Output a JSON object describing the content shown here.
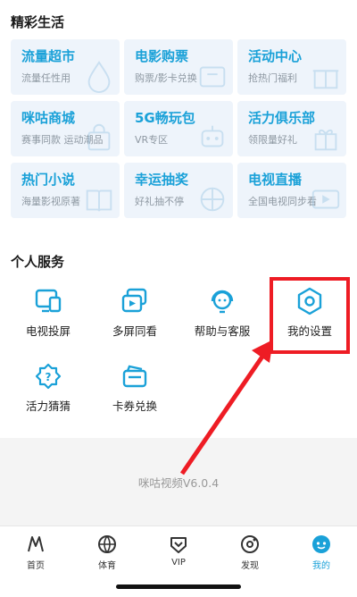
{
  "sections": {
    "featured_title": "精彩生活",
    "personal_title": "个人服务"
  },
  "cards": [
    {
      "title": "流量超市",
      "subtitle": "流量任性用"
    },
    {
      "title": "电影购票",
      "subtitle": "购票/影卡兑换"
    },
    {
      "title": "活动中心",
      "subtitle": "抢热门福利"
    },
    {
      "title": "咪咕商城",
      "subtitle": "赛事同款 运动潮品"
    },
    {
      "title": "5G畅玩包",
      "subtitle": "VR专区"
    },
    {
      "title": "活力俱乐部",
      "subtitle": "领限量好礼"
    },
    {
      "title": "热门小说",
      "subtitle": "海量影视原著"
    },
    {
      "title": "幸运抽奖",
      "subtitle": "好礼抽不停"
    },
    {
      "title": "电视直播",
      "subtitle": "全国电视同步看"
    }
  ],
  "services": [
    {
      "label": "电视投屏",
      "icon": "tv-cast-icon"
    },
    {
      "label": "多屏同看",
      "icon": "multi-screen-icon"
    },
    {
      "label": "帮助与客服",
      "icon": "customer-service-icon"
    },
    {
      "label": "我的设置",
      "icon": "settings-hexagon-icon"
    },
    {
      "label": "活力猜猜",
      "icon": "guess-question-icon"
    },
    {
      "label": "卡券兑换",
      "icon": "coupon-card-icon"
    }
  ],
  "footer": {
    "version": "咪咕视频V6.0.4"
  },
  "tabs": [
    {
      "label": "首页",
      "icon": "home-logo-icon",
      "active": false
    },
    {
      "label": "体育",
      "icon": "basketball-icon",
      "active": false
    },
    {
      "label": "VIP",
      "icon": "vip-diamond-icon",
      "active": false
    },
    {
      "label": "发现",
      "icon": "discover-icon",
      "active": false
    },
    {
      "label": "我的",
      "icon": "profile-face-icon",
      "active": true
    }
  ],
  "colors": {
    "accent": "#1aa1d8",
    "card_bg": "#eef4fb",
    "annotation_red": "#ee1c24"
  }
}
